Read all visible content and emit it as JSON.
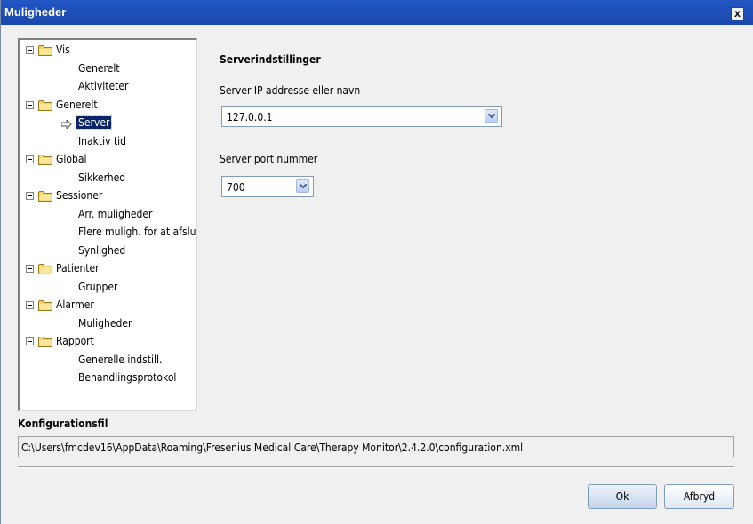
{
  "window": {
    "title": "Muligheder",
    "close_label": "x"
  },
  "tree": [
    {
      "label": "Vis",
      "level": 0,
      "expanded": true
    },
    {
      "label": "Generelt",
      "level": 1
    },
    {
      "label": "Aktiviteter",
      "level": 1
    },
    {
      "label": "Generelt",
      "level": 0,
      "expanded": true
    },
    {
      "label": "Server",
      "level": 1,
      "selected": true
    },
    {
      "label": "Inaktiv tid",
      "level": 1
    },
    {
      "label": "Global",
      "level": 0,
      "expanded": true
    },
    {
      "label": "Sikkerhed",
      "level": 1
    },
    {
      "label": "Sessioner",
      "level": 0,
      "expanded": true
    },
    {
      "label": "Arr. muligheder",
      "level": 1
    },
    {
      "label": "Flere muligh. for at afslutte",
      "level": 1
    },
    {
      "label": "Synlighed",
      "level": 1
    },
    {
      "label": "Patienter",
      "level": 0,
      "expanded": true
    },
    {
      "label": "Grupper",
      "level": 1
    },
    {
      "label": "Alarmer",
      "level": 0,
      "expanded": true
    },
    {
      "label": "Muligheder",
      "level": 1
    },
    {
      "label": "Rapport",
      "level": 0,
      "expanded": true
    },
    {
      "label": "Generelle indstill.",
      "level": 1
    },
    {
      "label": "Behandlingsprotokol",
      "level": 1
    }
  ],
  "server": {
    "section_title": "Serverindstillinger",
    "ip_label": "Server IP addresse eller navn",
    "ip_value": "127.0.0.1",
    "port_label": "Server port nummer",
    "port_value": "700"
  },
  "config": {
    "title": "Konfigurationsfil",
    "path": "C:\\Users\\fmcdev16\\AppData\\Roaming\\Fresenius Medical Care\\Therapy Monitor\\2.4.2.0\\configuration.xml"
  },
  "buttons": {
    "ok": "Ok",
    "cancel": "Afbryd"
  },
  "colors": {
    "titlebar": "#2256c4",
    "selection": "#0a246a",
    "folder": "#f2d46a"
  },
  "icons": {
    "folder": "folder-icon",
    "expander": "collapse-icon",
    "pointer": "arrow-right-icon",
    "dropdown": "chevron-down-icon"
  }
}
